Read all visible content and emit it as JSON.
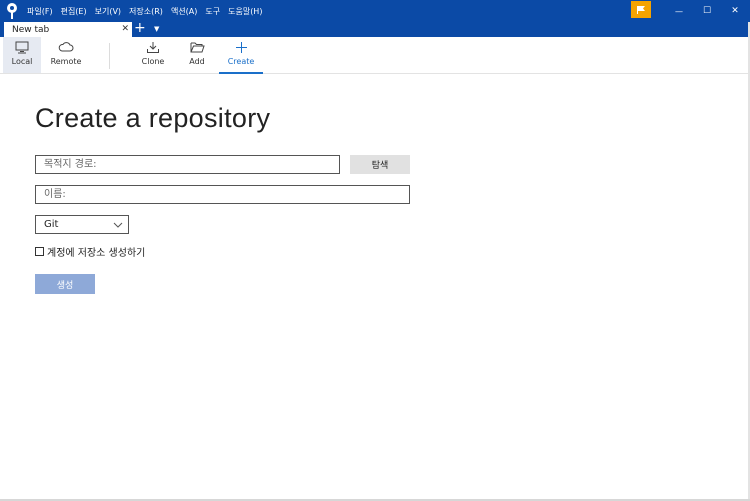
{
  "titlebar": {
    "menu": [
      "파일(F)",
      "편집(E)",
      "보기(V)",
      "저장소(R)",
      "액션(A)",
      "도구",
      "도움말(H)"
    ],
    "icons": {
      "app": "sourcetree-logo-icon",
      "flag": "flag-icon",
      "minimize": "minimize-icon",
      "maximize": "maximize-icon",
      "close": "close-icon"
    },
    "minimize_glyph": "—",
    "maximize_glyph": "☐",
    "close_glyph": "✕",
    "colors": {
      "bar": "#0b4aa6",
      "flag": "#f5a300"
    }
  },
  "tabs": {
    "items": [
      {
        "label": "New tab",
        "active": true
      }
    ],
    "close_glyph": "✕",
    "new_glyph": "+",
    "dropdown_glyph": "▼"
  },
  "toolbar": {
    "local": "Local",
    "remote": "Remote",
    "clone": "Clone",
    "add": "Add",
    "create": "Create",
    "active": "create",
    "accent": "#1a6fc9"
  },
  "form": {
    "title": "Create a repository",
    "destination_placeholder": "목적지 경로:",
    "destination_value": "",
    "browse_label": "탐색",
    "name_placeholder": "이름:",
    "name_value": "",
    "vcs_selected": "Git",
    "checkbox_label": "계정에 저장소 생성하기",
    "checkbox_checked": false,
    "create_label": "생성",
    "create_color": "#8ea9d8"
  }
}
